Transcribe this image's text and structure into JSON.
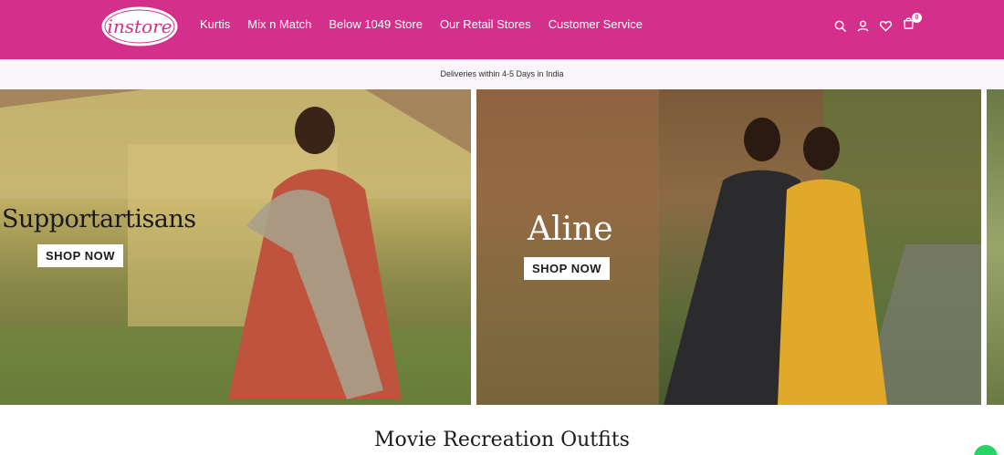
{
  "brand": {
    "logo_text": "instore",
    "primary_color": "#d42f8a"
  },
  "nav": {
    "items": [
      {
        "label": "Kurtis"
      },
      {
        "label": "Mix n Match"
      },
      {
        "label": "Below 1049 Store"
      },
      {
        "label": "Our Retail Stores"
      },
      {
        "label": "Customer Service"
      }
    ]
  },
  "header_icons": {
    "search": "search-icon",
    "account": "account-icon",
    "wishlist": "heart-icon",
    "cart": "cart-icon",
    "cart_count": "0"
  },
  "announcement": {
    "text": "Deliveries within 4-5 Days in India"
  },
  "slides": [
    {
      "title": "Supportartisans",
      "button_label": "SHOP NOW"
    },
    {
      "title": "Aline",
      "button_label": "SHOP NOW"
    }
  ],
  "section": {
    "title": "Movie Recreation Outfits"
  },
  "floating": {
    "whatsapp": "whatsapp-icon",
    "color": "#25d366"
  }
}
